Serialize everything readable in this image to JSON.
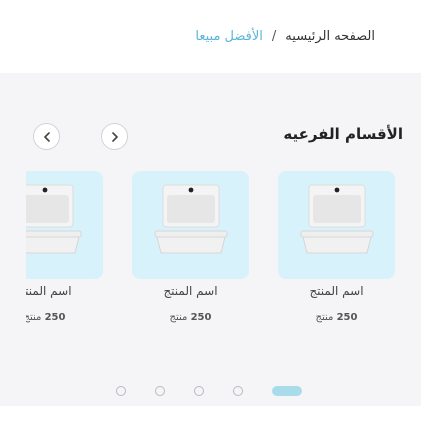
{
  "breadcrumb": {
    "home": "الصفحه الرئيسيه",
    "separator": "/",
    "current": "الأفضل مبيعا"
  },
  "section": {
    "title": "الأقسام الفرعيه",
    "next_icon": "chevron-right-icon",
    "prev_icon": "chevron-left-icon"
  },
  "products": [
    {
      "name": "اسم المنتج",
      "count": "250",
      "unit": "منتج",
      "icon": "sink-basin-image"
    },
    {
      "name": "اسم المنتج",
      "count": "250",
      "unit": "منتج",
      "icon": "sink-basin-image"
    },
    {
      "name": "اسم المنتج",
      "count": "250",
      "unit": "منتج",
      "icon": "sink-basin-image"
    }
  ],
  "pagination": {
    "pages": 5,
    "active_page": 1
  },
  "colors": {
    "accent": "#5bb5d8",
    "card_background": "#d8f2fb",
    "section_background": "#f5f5f7",
    "active_dot": "#a9dceb"
  }
}
